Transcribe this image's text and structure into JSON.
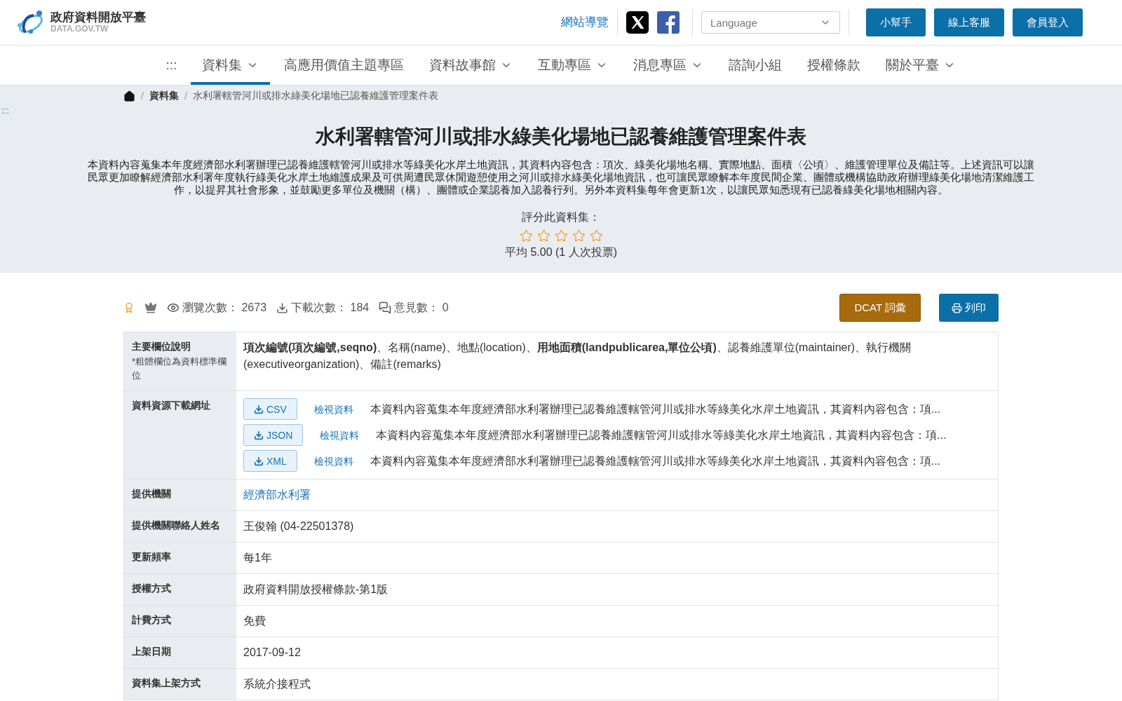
{
  "site": {
    "name": "政府資料開放平臺",
    "domain": "DATA.GOV.TW"
  },
  "top_links": [
    {
      "label": "網站導覽",
      "kind": "link"
    },
    {
      "kind": "x"
    },
    {
      "kind": "facebook"
    }
  ],
  "language": {
    "placeholder": "Language"
  },
  "top_buttons": [
    "小幫手",
    "線上客服",
    "會員登入"
  ],
  "nav": [
    {
      "label": ":::",
      "dropdown": false,
      "selected": false
    },
    {
      "label": "資料集",
      "dropdown": true,
      "selected": true
    },
    {
      "label": "高應用價值主題專區",
      "dropdown": false,
      "selected": false
    },
    {
      "label": "資料故事館",
      "dropdown": true,
      "selected": false
    },
    {
      "label": "互動專區",
      "dropdown": true,
      "selected": false
    },
    {
      "label": "消息專區",
      "dropdown": true,
      "selected": false
    },
    {
      "label": "諮詢小組",
      "dropdown": false,
      "selected": false
    },
    {
      "label": "授權條款",
      "dropdown": false,
      "selected": false
    },
    {
      "label": "關於平臺",
      "dropdown": true,
      "selected": false
    }
  ],
  "accesskey": ":::",
  "breadcrumb": [
    "資料集",
    "水利署轄管河川或排水綠美化場地已認養維護管理案件表"
  ],
  "breadcrumb_separator": "/",
  "title": "水利署轄管河川或排水綠美化場地已認養維護管理案件表",
  "description": "本資料內容蒐集本年度經濟部水利署辦理已認養維護轄管河川或排水等綠美化水岸土地資訊，其資料內容包含：項次、綠美化場地名稱、實際地點、面積〈公頃〉、維護管理單位及備註等。上述資訊可以讓民眾更加瞭解經濟部水利署年度執行綠美化水岸土地維護成果及可供周遭民眾休閒遊憩使用之河川或排水綠美化場地資訊，也可讓民眾瞭解本年度民間企業、團體或機構協助政府辦理綠美化場地清潔維護工作，以提昇其社會形象，並鼓勵更多單位及機關（構）、團體或企業認養加入認養行列。另外本資料集每年會更新1次，以讓民眾知悉現有已認養綠美化場地相關內容。",
  "rating": {
    "label": "評分此資料集：",
    "stars": 0,
    "summary": "平均 5.00 (1 人次投票)"
  },
  "stats": [
    {
      "kind": "views",
      "label": "瀏覽次數：",
      "value": "2673"
    },
    {
      "kind": "downloads",
      "label": "下載次數：",
      "value": "184"
    },
    {
      "kind": "comments",
      "label": "意見數：",
      "value": "0"
    }
  ],
  "actions": [
    {
      "kind": "dcat",
      "label": "DCAT 詞彙"
    },
    {
      "kind": "print",
      "label": "列印"
    }
  ],
  "fields": [
    {
      "kind": "rich",
      "label": "主要欄位說明",
      "note": "*粗體欄位為資料標準欄位",
      "value": "**項次編號(項次編號,seqno)**、名稱(name)、地點(location)、**用地面積(landpublicarea,單位公頃)**、認養維護單位(maintainer)、執行機關(executiveorganization)、備註(remarks)"
    },
    {
      "kind": "downloads",
      "label": "資料資源下載網址",
      "resources": [
        {
          "format": "CSV",
          "view": "檢視資料",
          "summary": "本資料內容蒐集本年度經濟部水利署辦理已認養維護轄管河川或排水等綠美化水岸土地資訊，其資料內容包含：項..."
        },
        {
          "format": "JSON",
          "view": "檢視資料",
          "summary": "本資料內容蒐集本年度經濟部水利署辦理已認養維護轄管河川或排水等綠美化水岸土地資訊，其資料內容包含：項..."
        },
        {
          "format": "XML",
          "view": "檢視資料",
          "summary": "本資料內容蒐集本年度經濟部水利署辦理已認養維護轄管河川或排水等綠美化水岸土地資訊，其資料內容包含：項..."
        }
      ]
    },
    {
      "kind": "link",
      "label": "提供機關",
      "value": "經濟部水利署"
    },
    {
      "kind": "text",
      "label": "提供機關聯絡人姓名",
      "value": "王俊翰 (04-22501378)"
    },
    {
      "kind": "text",
      "label": "更新頻率",
      "value": "每1年"
    },
    {
      "kind": "text",
      "label": "授權方式",
      "value": "政府資料開放授權條款-第1版"
    },
    {
      "kind": "text",
      "label": "計費方式",
      "value": "免費"
    },
    {
      "kind": "text",
      "label": "上架日期",
      "value": "2017-09-12"
    },
    {
      "kind": "text",
      "label": "資料集上架方式",
      "value": "系統介接程式"
    }
  ]
}
